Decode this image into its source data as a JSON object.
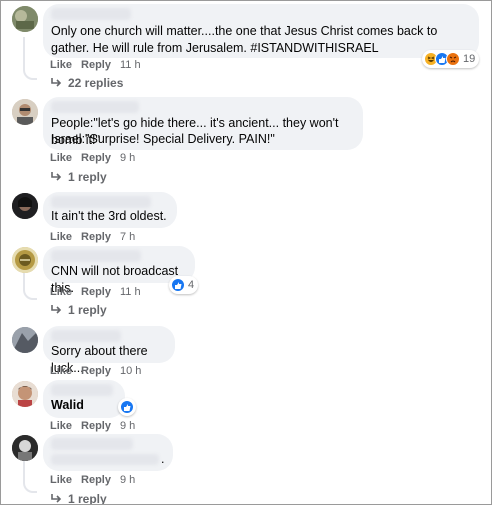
{
  "comments": [
    {
      "text": "Only one church will matter....the one that Jesus Christ comes back to gather. He will rule from Jerusalem. #ISTANDWITHISRAEL",
      "like": "Like",
      "reply": "Reply",
      "time": "11 h",
      "reactions": {
        "icons": [
          "haha-emoji-icon",
          "like-reaction-icon",
          "angry-emoji-icon"
        ],
        "count": "19"
      },
      "replies": "22 replies"
    },
    {
      "text_line1": "People:\"let's go hide there... it's ancient... they won't bomb it!\"",
      "text_line2": "Israel:\"Surprise! Special Delivery. PAIN!\"",
      "like": "Like",
      "reply": "Reply",
      "time": "9 h",
      "replies": "1 reply"
    },
    {
      "text": "It ain't the 3rd oldest.",
      "like": "Like",
      "reply": "Reply",
      "time": "7 h"
    },
    {
      "text": "CNN will not broadcast this.",
      "like": "Like",
      "reply": "Reply",
      "time": "11 h",
      "reactions": {
        "icons": [
          "like-reaction-icon"
        ],
        "count": "4"
      },
      "replies": "1 reply"
    },
    {
      "text": "Sorry about there luck...",
      "like": "Like",
      "reply": "Reply",
      "time": "10 h"
    },
    {
      "text": "Walid",
      "like": "Like",
      "reply": "Reply",
      "time": "9 h",
      "reactions": {
        "icons": [
          "like-reaction-icon"
        ],
        "count": ""
      }
    },
    {
      "text": ".",
      "like": "Like",
      "reply": "Reply",
      "time": "9 h",
      "replies": "1 reply"
    }
  ],
  "colors": {
    "bubble": "#f0f2f5",
    "secondary_text": "#65676b",
    "like_blue": "#1877f2",
    "angry": "#e9710f",
    "haha": "#f7b125"
  }
}
